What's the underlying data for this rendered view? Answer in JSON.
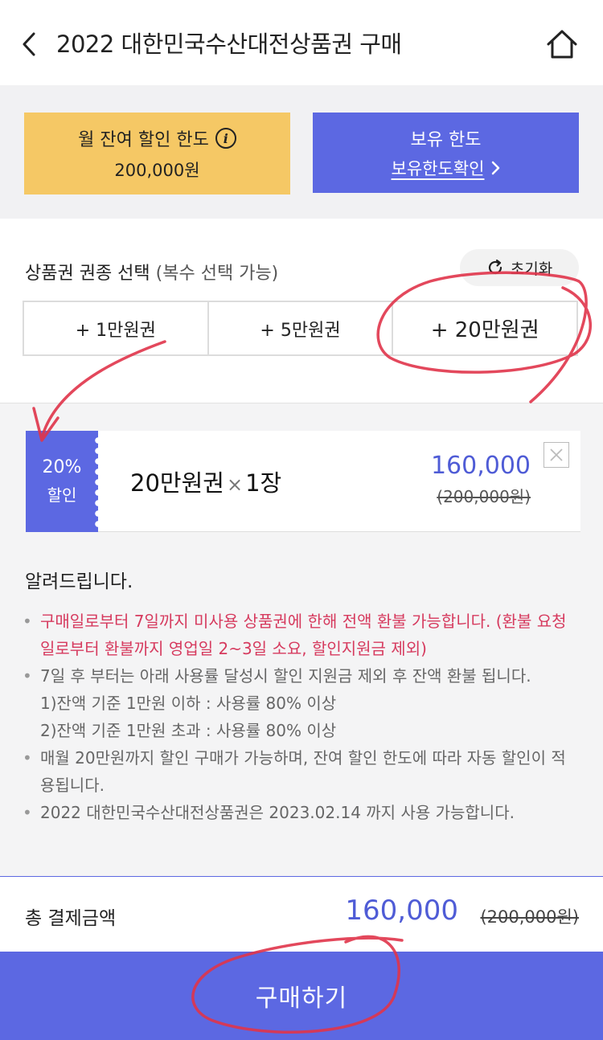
{
  "header": {
    "title": "2022 대한민국수산대전상품권 구매",
    "back_icon": "chevron-left-icon",
    "home_icon": "home-icon"
  },
  "limits": {
    "monthly_label": "월 잔여 할인 한도",
    "monthly_value": "200,000원",
    "own_label": "보유 한도",
    "own_link": "보유한도확인"
  },
  "selection": {
    "title": "상품권 권종 선택",
    "subtitle": "(복수 선택 가능)",
    "reset_label": "초기화",
    "options": [
      {
        "label": "+ 1만원권"
      },
      {
        "label": "+ 5만원권"
      },
      {
        "label": "+ 20만원권"
      }
    ]
  },
  "cart": {
    "discount_pct": "20%",
    "discount_label": "할인",
    "item": "20만원권",
    "multiply": "×",
    "quantity": "1장",
    "price": "160,000",
    "original_price": "(200,000원)"
  },
  "notice": {
    "title": "알려드립니다.",
    "items": [
      "구매일로부터 7일까지 미사용 상품권에 한해 전액 환불 가능합니다. (환불 요청일로부터 환불까지 영업일 2~3일 소요, 할인지원금 제외)",
      "7일 후 부터는 아래 사용률 달성시 할인 지원금 제외 후 잔액 환불 됩니다.",
      "매월 20만원까지 할인 구매가 가능하며, 잔여 할인 한도에 따라 자동 할인이 적용됩니다.",
      "2022 대한민국수산대전상품권은 2023.02.14 까지 사용 가능합니다."
    ],
    "sub_items": [
      "1)잔액 기준 1만원 이하 : 사용률 80% 이상",
      "2)잔액 기준 1만원 초과 : 사용률 80% 이상"
    ]
  },
  "total": {
    "label": "총 결제금액",
    "value": "160,000",
    "original": "(200,000원)"
  },
  "buy_label": "구매하기",
  "colors": {
    "accent": "#5c68e2",
    "yellow": "#f5c865",
    "price_blue": "#4f5cd6",
    "notice_red": "#d63a5e",
    "annotation_red": "#e0344a"
  }
}
